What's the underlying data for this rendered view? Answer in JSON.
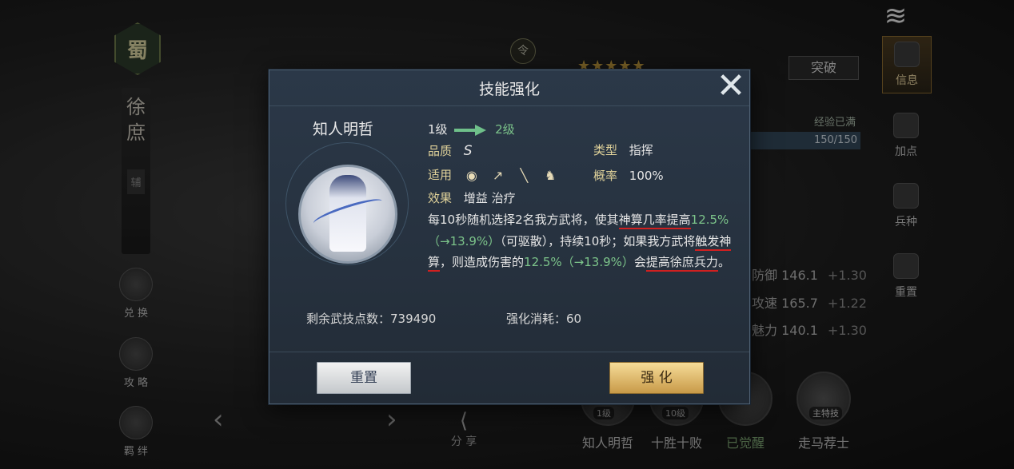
{
  "background": {
    "faction": "蜀",
    "hero_name_chars": [
      "徐",
      "庶"
    ],
    "hero_role_tag": "辅",
    "left_buttons": [
      {
        "label": "兑 换",
        "icon": "exchange-icon"
      },
      {
        "label": "攻 略",
        "icon": "guide-scroll-icon"
      },
      {
        "label": "羁 绊",
        "icon": "bond-book-icon"
      }
    ],
    "stars": "★★★★★",
    "ling_badge": "令",
    "breakthrough_label": "突破",
    "exp_label": "经验已满",
    "exp_value": "150/150",
    "exp_fraction": 1.0,
    "stats": [
      {
        "name": "防御",
        "value": "146.1",
        "plus": "+1.30"
      },
      {
        "name": "攻速",
        "value": "165.7",
        "plus": "+1.22"
      },
      {
        "name": "魅力",
        "value": "140.1",
        "plus": "+1.30"
      }
    ],
    "right_nav": [
      {
        "label": "信息",
        "icon": "info-scroll-icon",
        "active": true
      },
      {
        "label": "加点",
        "icon": "add-points-icon",
        "active": false
      },
      {
        "label": "兵种",
        "icon": "helmet-icon",
        "active": false
      },
      {
        "label": "重置",
        "icon": "reset-icon",
        "active": false
      }
    ],
    "skills": [
      {
        "name": "知人明哲",
        "level": "1级"
      },
      {
        "name": "十胜十败",
        "level": "10级"
      },
      {
        "name": "已觉醒",
        "level": ""
      },
      {
        "name": "走马荐士",
        "level": "主特技"
      }
    ],
    "share_label": "分 享"
  },
  "dialog": {
    "title": "技能强化",
    "skill_name": "知人明哲",
    "level_from": "1级",
    "level_to": "2级",
    "quality_label": "品质",
    "quality_value": "S",
    "type_label": "类型",
    "type_value": "指挥",
    "applicable_label": "适用",
    "applicable_icons": [
      "shield-unit-icon",
      "bow-unit-icon",
      "spear-unit-icon",
      "cavalry-unit-icon"
    ],
    "chance_label": "概率",
    "chance_value": "100%",
    "effect_label": "效果",
    "effect_value": "增益 治疗",
    "desc": {
      "p1": "每10秒随机选择2名我方武将，使其",
      "u1": "神算几率提高",
      "g1": "12.5%（→13.9%）",
      "p2": "（可驱散），持续10秒；如果我方武将",
      "u2": "触发神算",
      "p3": "，则造成伤害的",
      "g2": "12.5%（→13.9%）",
      "p4": "会",
      "u3": "提高徐庶兵力",
      "p5": "。"
    },
    "remaining_points_label": "剩余武技点数：",
    "remaining_points_value": "739490",
    "cost_label": "强化消耗：",
    "cost_value": "60",
    "reset_button": "重置",
    "upgrade_button": "强 化"
  }
}
